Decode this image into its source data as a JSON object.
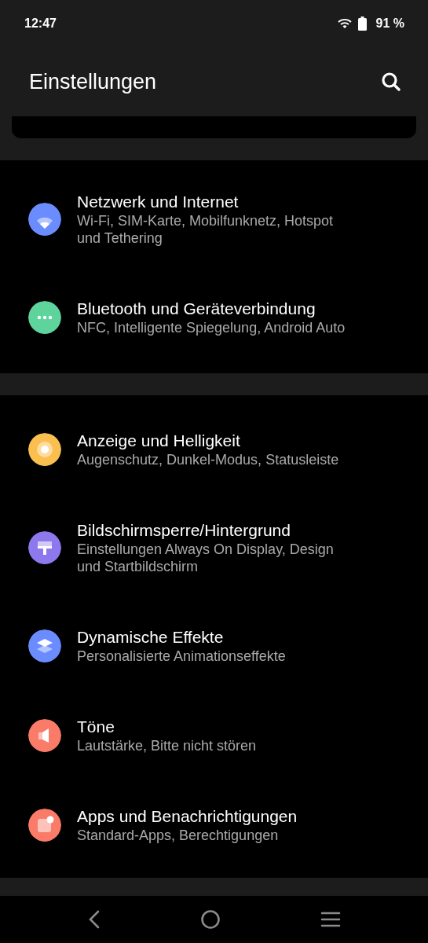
{
  "status_bar": {
    "time": "12:47",
    "battery": "91 %"
  },
  "header": {
    "title": "Einstellungen"
  },
  "groups": [
    {
      "items": [
        {
          "kind": "wifi",
          "color": "#6b8cff",
          "title": "Netzwerk und Internet",
          "subtitle": "Wi-Fi, SIM-Karte, Mobilfunknetz, Hotspot und Tethering"
        },
        {
          "kind": "dots",
          "color": "#5ed49c",
          "title": "Bluetooth und Geräteverbindung",
          "subtitle": "NFC, Intelligente Spiegelung, Android Auto"
        }
      ]
    },
    {
      "items": [
        {
          "kind": "sun",
          "color": "#fbbf4f",
          "title": "Anzeige und Helligkeit",
          "subtitle": "Augenschutz, Dunkel-Modus, Statusleiste"
        },
        {
          "kind": "brush",
          "color": "#8d78ee",
          "title": "Bildschirmsperre/Hintergrund",
          "subtitle": "Einstellungen Always On Display, Design und Startbildschirm"
        },
        {
          "kind": "layers",
          "color": "#6b8cff",
          "title": "Dynamische Effekte",
          "subtitle": "Personalisierte Animationseffekte"
        },
        {
          "kind": "speaker",
          "color": "#fa7b68",
          "title": "Töne",
          "subtitle": "Lautstärke, Bitte nicht stören"
        },
        {
          "kind": "apps",
          "color": "#fa7b68",
          "title": "Apps und Benachrichtigungen",
          "subtitle": "Standard-Apps, Berechtigungen"
        }
      ]
    }
  ]
}
